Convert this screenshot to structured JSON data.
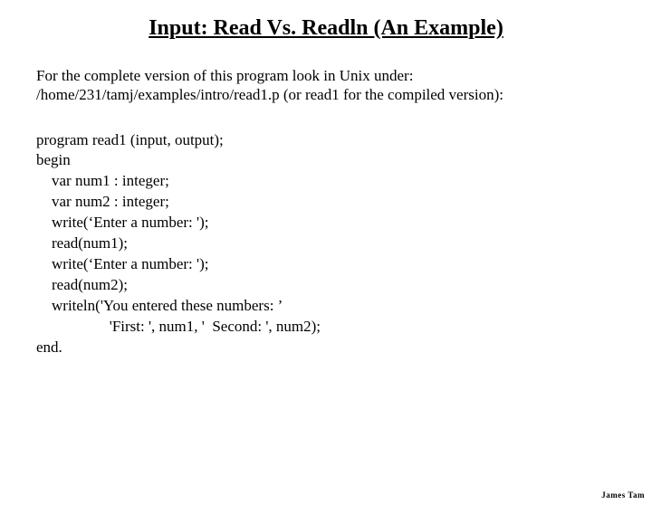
{
  "title": "Input: Read Vs. Readln (An Example)",
  "intro_line1": "For the complete version of this program look in Unix under:",
  "intro_line2": "/home/231/tamj/examples/intro/read1.p (or read1 for the compiled version):",
  "code": "program read1 (input, output);\nbegin\n    var num1 : integer;\n    var num2 : integer;\n    write(‘Enter a number: ');\n    read(num1);\n    write(‘Enter a number: ');\n    read(num2);\n    writeln('You entered these numbers: ’\n                   'First: ', num1, '  Second: ', num2);\nend.",
  "footer": "James Tam"
}
